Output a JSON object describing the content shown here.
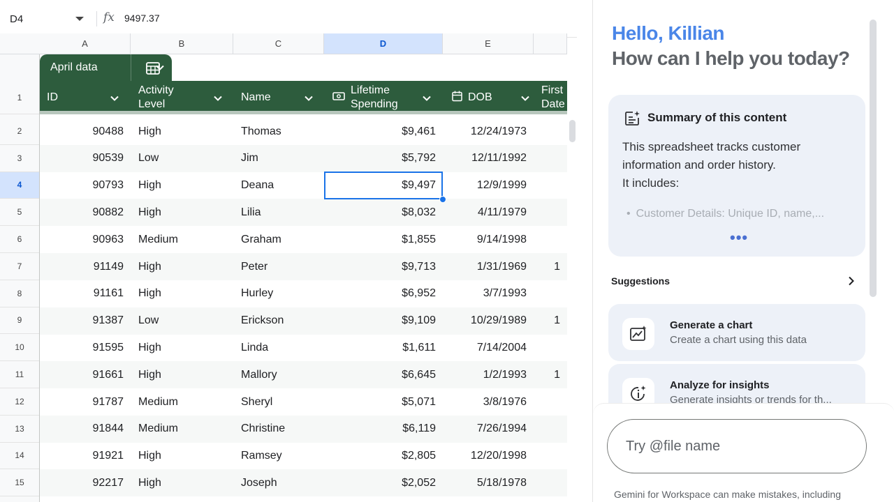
{
  "formula_bar": {
    "cell_ref": "D4",
    "fx": "fx",
    "value": "9497.37"
  },
  "columns": [
    "A",
    "B",
    "C",
    "D",
    "E"
  ],
  "selected_column": "D",
  "table": {
    "name": "April data",
    "headers": {
      "id": "ID",
      "activity_1": "Activity",
      "activity_2": "Level",
      "name": "Name",
      "spending_1": "Lifetime",
      "spending_2": "Spending",
      "dob": "DOB",
      "first_1": "First",
      "first_2": "Date"
    },
    "header_row_number": "1",
    "rows": [
      {
        "n": "2",
        "id": "90488",
        "level": "High",
        "name": "Thomas",
        "spend": "$9,461",
        "dob": "12/24/1973",
        "first": ""
      },
      {
        "n": "3",
        "id": "90539",
        "level": "Low",
        "name": "Jim",
        "spend": "$5,792",
        "dob": "12/11/1992",
        "first": ""
      },
      {
        "n": "4",
        "id": "90793",
        "level": "High",
        "name": "Deana",
        "spend": "$9,497",
        "dob": "12/9/1999",
        "first": ""
      },
      {
        "n": "5",
        "id": "90882",
        "level": "High",
        "name": "Lilia",
        "spend": "$8,032",
        "dob": "4/11/1979",
        "first": ""
      },
      {
        "n": "6",
        "id": "90963",
        "level": "Medium",
        "name": "Graham",
        "spend": "$1,855",
        "dob": "9/14/1998",
        "first": ""
      },
      {
        "n": "7",
        "id": "91149",
        "level": "High",
        "name": "Peter",
        "spend": "$9,713",
        "dob": "1/31/1969",
        "first": "1"
      },
      {
        "n": "8",
        "id": "91161",
        "level": "High",
        "name": "Hurley",
        "spend": "$6,952",
        "dob": "3/7/1993",
        "first": ""
      },
      {
        "n": "9",
        "id": "91387",
        "level": "Low",
        "name": "Erickson",
        "spend": "$9,109",
        "dob": "10/29/1989",
        "first": "1"
      },
      {
        "n": "10",
        "id": "91595",
        "level": "High",
        "name": "Linda",
        "spend": "$1,611",
        "dob": "7/14/2004",
        "first": ""
      },
      {
        "n": "11",
        "id": "91661",
        "level": "High",
        "name": "Mallory",
        "spend": "$6,645",
        "dob": "1/2/1993",
        "first": "1"
      },
      {
        "n": "12",
        "id": "91787",
        "level": "Medium",
        "name": "Sheryl",
        "spend": "$5,071",
        "dob": "3/8/1976",
        "first": ""
      },
      {
        "n": "13",
        "id": "91844",
        "level": "Medium",
        "name": "Christine",
        "spend": "$6,119",
        "dob": "7/26/1994",
        "first": ""
      },
      {
        "n": "14",
        "id": "91921",
        "level": "High",
        "name": "Ramsey",
        "spend": "$2,805",
        "dob": "12/20/1998",
        "first": ""
      },
      {
        "n": "15",
        "id": "92217",
        "level": "High",
        "name": "Joseph",
        "spend": "$2,052",
        "dob": "5/18/1978",
        "first": ""
      }
    ],
    "selected_row": "4"
  },
  "panel": {
    "greeting_name": "Hello, Killian",
    "greeting_question": "How can I help you today?",
    "summary": {
      "title": "Summary of this content",
      "text": "This spreadsheet tracks customer information and order history.",
      "text_2": "It includes:",
      "bullet": "Customer Details: Unique ID, name,...",
      "more": "•••"
    },
    "suggestions_label": "Suggestions",
    "suggestions": [
      {
        "title": "Generate a chart",
        "subtitle": "Create a chart using this data",
        "icon": "chart-sparkle-icon"
      },
      {
        "title": "Analyze for insights",
        "subtitle": "Generate insights or trends for th...",
        "icon": "insights-icon"
      }
    ],
    "input_placeholder": "Try @file name",
    "disclaimer": "Gemini for Workspace can make mistakes, including"
  },
  "colors": {
    "table_header": "#2d5c3d",
    "selection": "#1a73e8",
    "greeting": "#4a86e8",
    "card_bg": "#edf1f8"
  }
}
